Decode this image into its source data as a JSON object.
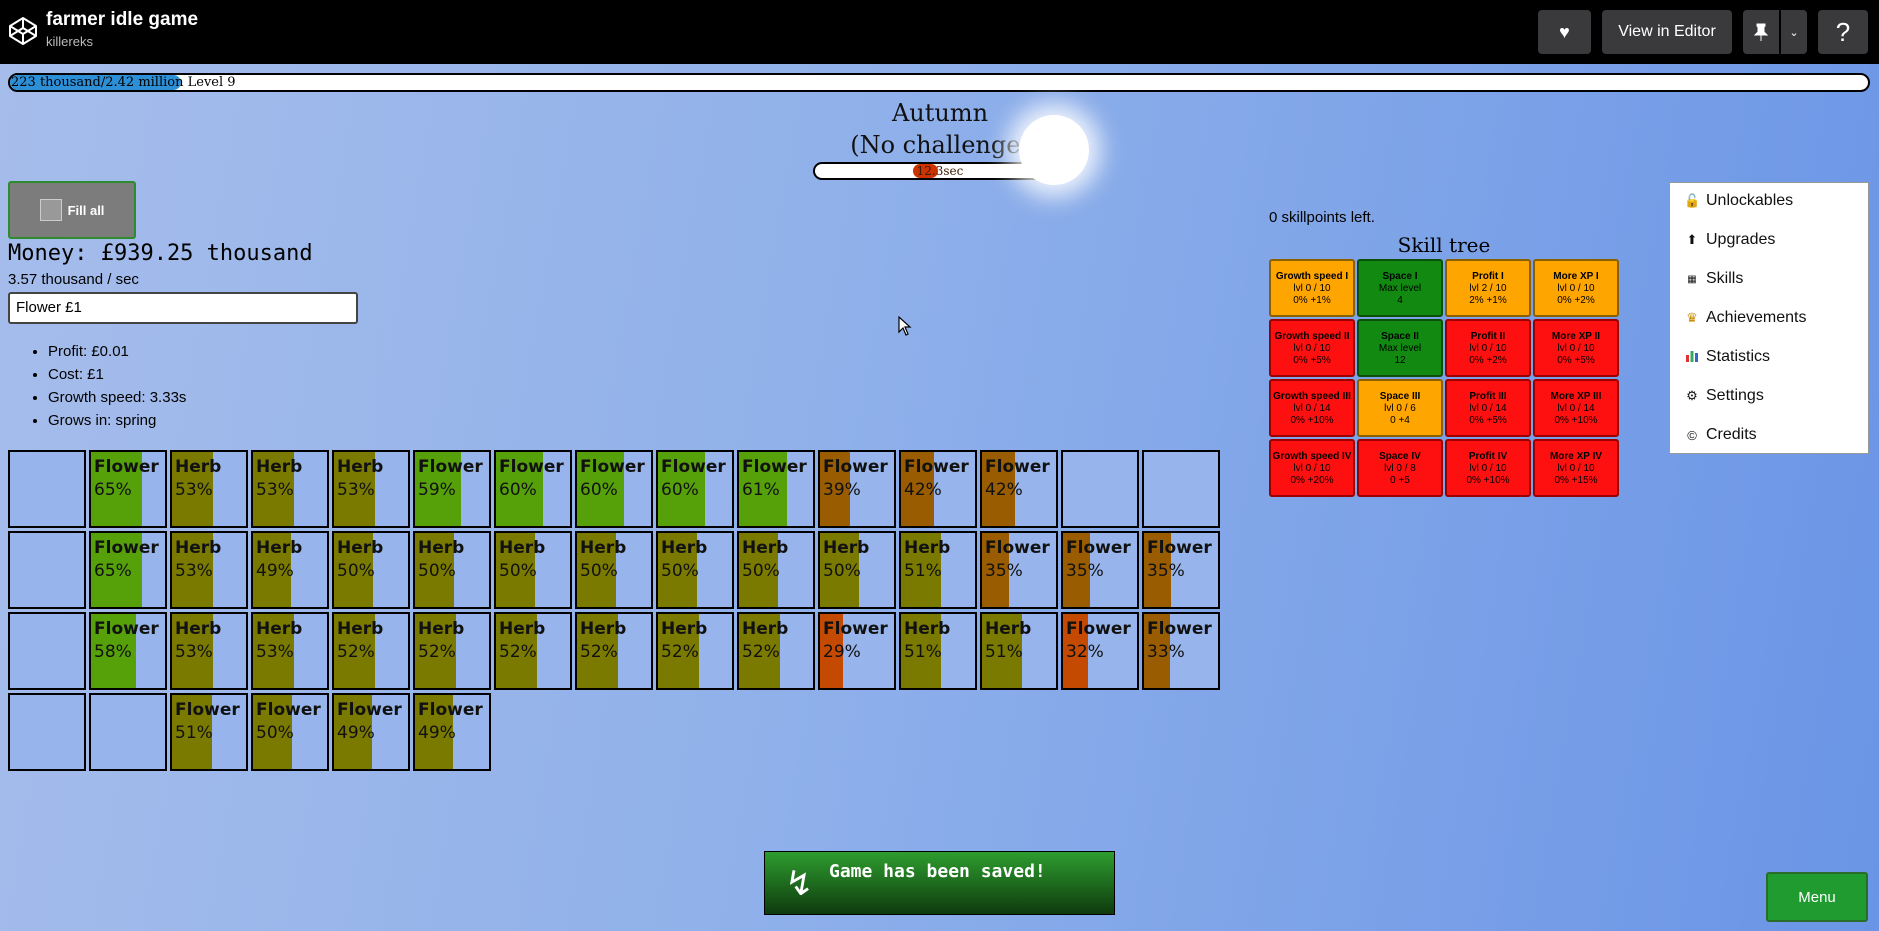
{
  "header": {
    "title": "farmer idle game",
    "author": "killereks",
    "view_in_editor": "View in Editor",
    "help": "?"
  },
  "xp": {
    "text": "223 thousand/2.42 million",
    "level": "Level 9",
    "progress_fraction": 0.092
  },
  "season": {
    "name": "Autumn",
    "challenge": "(No challenge)",
    "timer": "12.3sec",
    "timer_fraction": 0.1
  },
  "fill_all_label": "Fill all",
  "money": "Money: £939.25 thousand",
  "rate": "3.57 thousand / sec",
  "selected_plant": "Flower £1",
  "stats": [
    "Profit: £0.01",
    "Cost: £1",
    "Growth speed: 3.33s",
    "Grows in: spring"
  ],
  "colors": {
    "green_grow": "#56a00a",
    "olive_grow": "#7a7a00",
    "brown_grow": "#995c00",
    "red_grow": "#c34a00",
    "skill_orange": "#ffa500",
    "skill_green": "#128a12",
    "skill_red": "#ff1010"
  },
  "field": [
    [
      null,
      {
        "name": "Flower",
        "pct": "65%",
        "value": 0.65,
        "color": "green"
      },
      {
        "name": "Herb",
        "pct": "53%",
        "value": 0.53,
        "color": "olive"
      },
      {
        "name": "Herb",
        "pct": "53%",
        "value": 0.53,
        "color": "olive"
      },
      {
        "name": "Herb",
        "pct": "53%",
        "value": 0.53,
        "color": "olive"
      },
      {
        "name": "Flower",
        "pct": "59%",
        "value": 0.59,
        "color": "green"
      },
      {
        "name": "Flower",
        "pct": "60%",
        "value": 0.6,
        "color": "green"
      },
      {
        "name": "Flower",
        "pct": "60%",
        "value": 0.6,
        "color": "green"
      },
      {
        "name": "Flower",
        "pct": "60%",
        "value": 0.6,
        "color": "green"
      },
      {
        "name": "Flower",
        "pct": "61%",
        "value": 0.61,
        "color": "green"
      },
      {
        "name": "Flower",
        "pct": "39%",
        "value": 0.39,
        "color": "brown"
      },
      {
        "name": "Flower",
        "pct": "42%",
        "value": 0.42,
        "color": "brown"
      },
      {
        "name": "Flower",
        "pct": "42%",
        "value": 0.42,
        "color": "brown"
      },
      null,
      null
    ],
    [
      null,
      {
        "name": "Flower",
        "pct": "65%",
        "value": 0.65,
        "color": "green"
      },
      {
        "name": "Herb",
        "pct": "53%",
        "value": 0.53,
        "color": "olive"
      },
      {
        "name": "Herb",
        "pct": "49%",
        "value": 0.49,
        "color": "olive"
      },
      {
        "name": "Herb",
        "pct": "50%",
        "value": 0.5,
        "color": "olive"
      },
      {
        "name": "Herb",
        "pct": "50%",
        "value": 0.5,
        "color": "olive"
      },
      {
        "name": "Herb",
        "pct": "50%",
        "value": 0.5,
        "color": "olive"
      },
      {
        "name": "Herb",
        "pct": "50%",
        "value": 0.5,
        "color": "olive"
      },
      {
        "name": "Herb",
        "pct": "50%",
        "value": 0.5,
        "color": "olive"
      },
      {
        "name": "Herb",
        "pct": "50%",
        "value": 0.5,
        "color": "olive"
      },
      {
        "name": "Herb",
        "pct": "50%",
        "value": 0.5,
        "color": "olive"
      },
      {
        "name": "Herb",
        "pct": "51%",
        "value": 0.51,
        "color": "olive"
      },
      {
        "name": "Flower",
        "pct": "35%",
        "value": 0.35,
        "color": "brown"
      },
      {
        "name": "Flower",
        "pct": "35%",
        "value": 0.35,
        "color": "brown"
      },
      {
        "name": "Flower",
        "pct": "35%",
        "value": 0.35,
        "color": "brown"
      }
    ],
    [
      null,
      {
        "name": "Flower",
        "pct": "58%",
        "value": 0.58,
        "color": "green"
      },
      {
        "name": "Herb",
        "pct": "53%",
        "value": 0.53,
        "color": "olive"
      },
      {
        "name": "Herb",
        "pct": "53%",
        "value": 0.53,
        "color": "olive"
      },
      {
        "name": "Herb",
        "pct": "52%",
        "value": 0.52,
        "color": "olive"
      },
      {
        "name": "Herb",
        "pct": "52%",
        "value": 0.52,
        "color": "olive"
      },
      {
        "name": "Herb",
        "pct": "52%",
        "value": 0.52,
        "color": "olive"
      },
      {
        "name": "Herb",
        "pct": "52%",
        "value": 0.52,
        "color": "olive"
      },
      {
        "name": "Herb",
        "pct": "52%",
        "value": 0.52,
        "color": "olive"
      },
      {
        "name": "Herb",
        "pct": "52%",
        "value": 0.52,
        "color": "olive"
      },
      {
        "name": "Flower",
        "pct": "29%",
        "value": 0.29,
        "color": "red"
      },
      {
        "name": "Herb",
        "pct": "51%",
        "value": 0.51,
        "color": "olive"
      },
      {
        "name": "Herb",
        "pct": "51%",
        "value": 0.51,
        "color": "olive"
      },
      {
        "name": "Flower",
        "pct": "32%",
        "value": 0.32,
        "color": "red"
      },
      {
        "name": "Flower",
        "pct": "33%",
        "value": 0.33,
        "color": "brown"
      }
    ],
    [
      null,
      null,
      {
        "name": "Flower",
        "pct": "51%",
        "value": 0.51,
        "color": "olive"
      },
      {
        "name": "Flower",
        "pct": "50%",
        "value": 0.5,
        "color": "olive"
      },
      {
        "name": "Flower",
        "pct": "49%",
        "value": 0.49,
        "color": "olive"
      },
      {
        "name": "Flower",
        "pct": "49%",
        "value": 0.49,
        "color": "olive"
      }
    ]
  ],
  "skills": {
    "points_left": "0 skillpoints left.",
    "title": "Skill tree",
    "grid": [
      [
        {
          "name": "Growth speed I",
          "lvl": "lvl 0 / 10",
          "eff": "0% +1%",
          "state": "orange"
        },
        {
          "name": "Space I",
          "lvl": "Max level",
          "eff": "4",
          "state": "green"
        },
        {
          "name": "Profit I",
          "lvl": "lvl 2 / 10",
          "eff": "2% +1%",
          "state": "orange"
        },
        {
          "name": "More XP I",
          "lvl": "lvl 0 / 10",
          "eff": "0% +2%",
          "state": "orange"
        }
      ],
      [
        {
          "name": "Growth speed II",
          "lvl": "lvl 0 / 10",
          "eff": "0% +5%",
          "state": "red"
        },
        {
          "name": "Space II",
          "lvl": "Max level",
          "eff": "12",
          "state": "green"
        },
        {
          "name": "Profit II",
          "lvl": "lvl 0 / 10",
          "eff": "0% +2%",
          "state": "red"
        },
        {
          "name": "More XP II",
          "lvl": "lvl 0 / 10",
          "eff": "0% +5%",
          "state": "red"
        }
      ],
      [
        {
          "name": "Growth speed III",
          "lvl": "lvl 0 / 14",
          "eff": "0% +10%",
          "state": "red"
        },
        {
          "name": "Space III",
          "lvl": "lvl 0 / 6",
          "eff": "0 +4",
          "state": "orange"
        },
        {
          "name": "Profit III",
          "lvl": "lvl 0 / 14",
          "eff": "0% +5%",
          "state": "red"
        },
        {
          "name": "More XP III",
          "lvl": "lvl 0 / 14",
          "eff": "0% +10%",
          "state": "red"
        }
      ],
      [
        {
          "name": "Growth speed IV",
          "lvl": "lvl 0 / 10",
          "eff": "0% +20%",
          "state": "red"
        },
        {
          "name": "Space IV",
          "lvl": "lvl 0 / 8",
          "eff": "0 +5",
          "state": "red"
        },
        {
          "name": "Profit IV",
          "lvl": "lvl 0 / 10",
          "eff": "0% +10%",
          "state": "red"
        },
        {
          "name": "More XP IV",
          "lvl": "lvl 0 / 10",
          "eff": "0% +15%",
          "state": "red"
        }
      ]
    ]
  },
  "menu": {
    "items": [
      {
        "label": "Unlockables",
        "icon": "lock-icon"
      },
      {
        "label": "Upgrades",
        "icon": "arrow-up-circle-icon"
      },
      {
        "label": "Skills",
        "icon": "skills-icon"
      },
      {
        "label": "Achievements",
        "icon": "trophy-icon"
      },
      {
        "label": "Statistics",
        "icon": "bar-chart-icon"
      },
      {
        "label": "Settings",
        "icon": "gear-icon"
      },
      {
        "label": "Credits",
        "icon": "copyright-icon"
      }
    ],
    "button": "Menu"
  },
  "toast": "Game has been saved!"
}
